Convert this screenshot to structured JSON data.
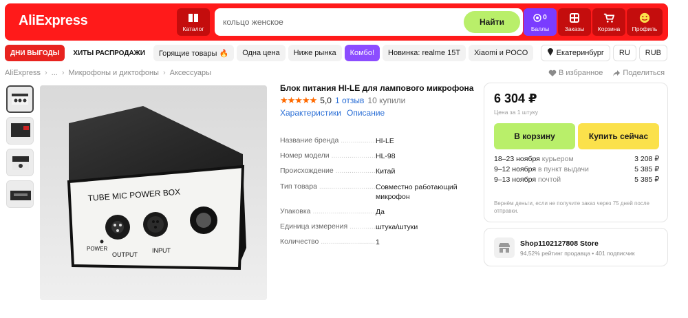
{
  "header": {
    "logo": "AliExpress",
    "catalog_label": "Каталог",
    "search_value": "кольцо женское",
    "search_button": "Найти",
    "points_count": "0",
    "points_label": "Баллы",
    "orders_label": "Заказы",
    "cart_label": "Корзина",
    "profile_label": "Профиль",
    "colors": {
      "brand": "#ff1a1a",
      "accent_green": "#b9ef6a",
      "points_purple": "#7a3cff"
    }
  },
  "nav": {
    "items": [
      "ДНИ ВЫГОДЫ",
      "ХИТЫ РАСПРОДАЖИ",
      "Горящие товары 🔥",
      "Одна цена",
      "Ниже рынка",
      "Комбо!",
      "Новинка: realme 15T",
      "Xiaomi и POCO"
    ],
    "city": "Екатеринбург",
    "lang": "RU",
    "currency": "RUB"
  },
  "breadcrumb": {
    "items": [
      "AliExpress",
      "...",
      "Микрофоны и диктофоны",
      "Аксессуары"
    ],
    "favorite": "В избранное",
    "share": "Поделиться"
  },
  "photo": {
    "label_title": "TUBE MIC POWER BOX",
    "label_power": "POWER",
    "label_output": "OUTPUT",
    "label_input": "INPUT"
  },
  "product": {
    "title": "Блок питания HI-LE для лампового микрофона",
    "stars": "★★★★★",
    "rating": "5,0",
    "reviews": "1 отзыв",
    "sold": "10 купили",
    "tab_specs": "Характеристики",
    "tab_desc": "Описание",
    "specs": [
      {
        "k": "Название бренда",
        "v": "HI-LE"
      },
      {
        "k": "Номер модели",
        "v": "HL-98"
      },
      {
        "k": "Происхождение",
        "v": "Китай"
      },
      {
        "k": "Тип товара",
        "v": "Совместно работающий микрофон"
      },
      {
        "k": "Упаковка",
        "v": "Да"
      },
      {
        "k": "Единица измерения",
        "v": "штука/штуки"
      },
      {
        "k": "Количество",
        "v": "1"
      }
    ]
  },
  "buy": {
    "price": "6 304 ₽",
    "per_unit": "Цена за 1 штуку",
    "cart_button": "В корзину",
    "buy_button": "Купить сейчас",
    "delivery": [
      {
        "date": "18–23 ноября",
        "how": "курьером",
        "price": "3 208 ₽"
      },
      {
        "date": "9–12 ноября",
        "how": "в пункт выдачи",
        "price": "5 385 ₽"
      },
      {
        "date": "9–13 ноября",
        "how": "почтой",
        "price": "5 385 ₽"
      }
    ],
    "refund": "Вернём деньги, если не получите заказ через 75 дней после отправки."
  },
  "store": {
    "name": "Shop1102127808 Store",
    "meta": "94,52% рейтинг продавца • 401 подписчик"
  }
}
